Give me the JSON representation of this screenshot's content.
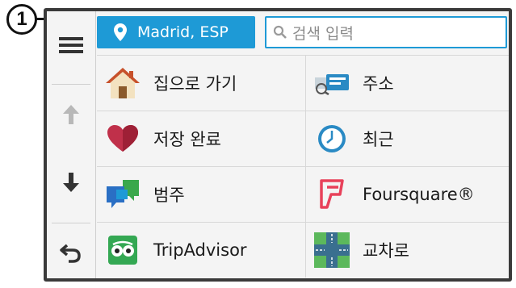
{
  "callout": {
    "number": "1"
  },
  "header": {
    "location_label": "Madrid, ESP",
    "search_placeholder": "검색 입력"
  },
  "sidebar": {
    "items": [
      {
        "icon": "menu-icon"
      },
      {
        "icon": "arrow-up-icon"
      },
      {
        "icon": "arrow-down-icon"
      },
      {
        "icon": "back-icon"
      }
    ]
  },
  "categories": [
    {
      "label": "집으로 가기",
      "icon": "home-icon"
    },
    {
      "label": "주소",
      "icon": "address-icon"
    },
    {
      "label": "저장 완료",
      "icon": "heart-icon"
    },
    {
      "label": "최근",
      "icon": "clock-icon"
    },
    {
      "label": "범주",
      "icon": "categories-icon"
    },
    {
      "label": "Foursquare®",
      "icon": "foursquare-icon"
    },
    {
      "label": "TripAdvisor",
      "icon": "tripadvisor-icon"
    },
    {
      "label": "교차로",
      "icon": "intersection-icon"
    }
  ],
  "colors": {
    "accent": "#1e9ad6",
    "heart": "#c0304a",
    "foursquare": "#e8415a"
  }
}
